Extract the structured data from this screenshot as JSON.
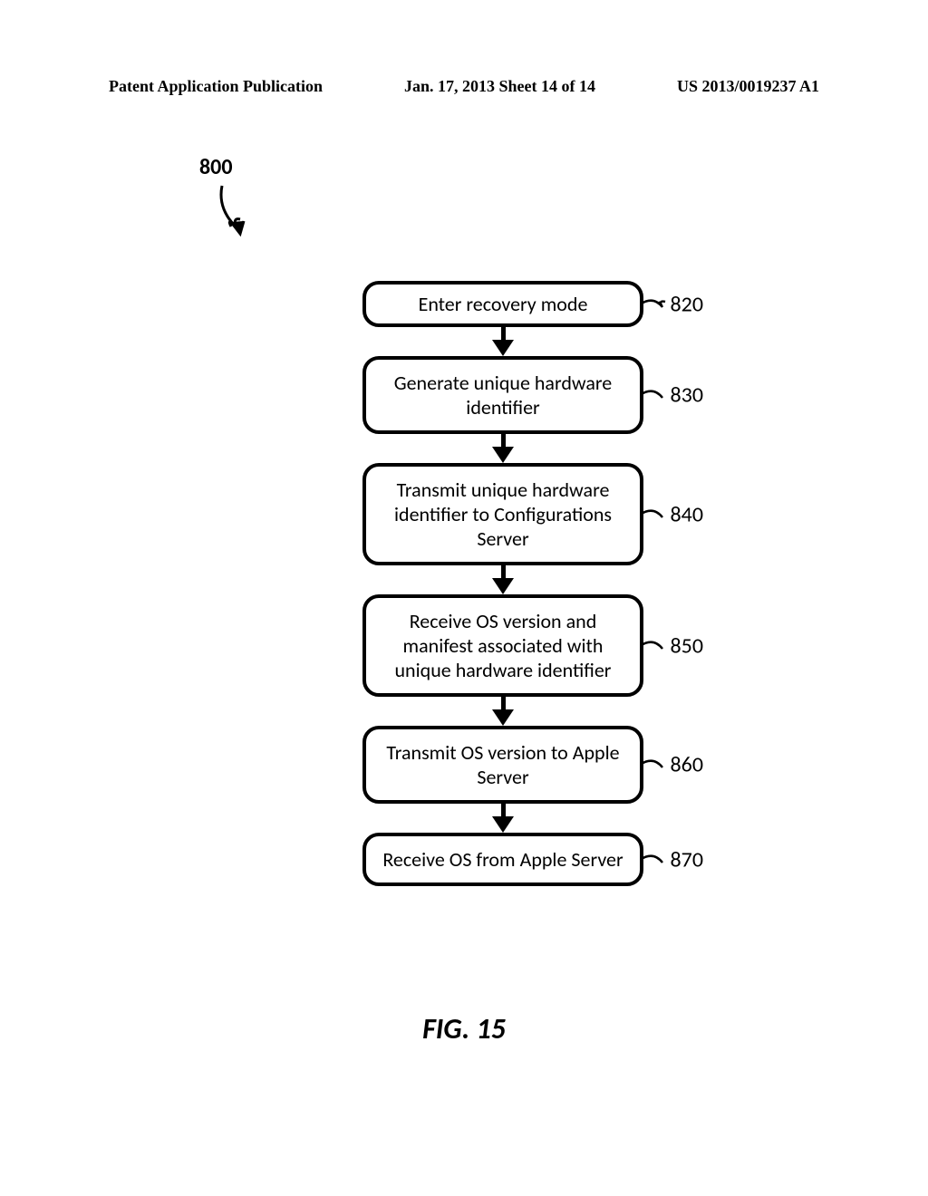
{
  "header": {
    "left": "Patent Application Publication",
    "center": "Jan. 17, 2013  Sheet 14 of 14",
    "right": "US 2013/0019237 A1"
  },
  "figure": {
    "reference": "800",
    "title": "FIG. 15",
    "steps": [
      {
        "number": "820",
        "text": "Enter recovery mode"
      },
      {
        "number": "830",
        "text": "Generate unique hardware identifier"
      },
      {
        "number": "840",
        "text": "Transmit unique hardware identifier to Configurations Server"
      },
      {
        "number": "850",
        "text": "Receive OS version and manifest associated with unique hardware identifier"
      },
      {
        "number": "860",
        "text": "Transmit OS version to Apple Server"
      },
      {
        "number": "870",
        "text": "Receive OS from Apple Server"
      }
    ]
  }
}
